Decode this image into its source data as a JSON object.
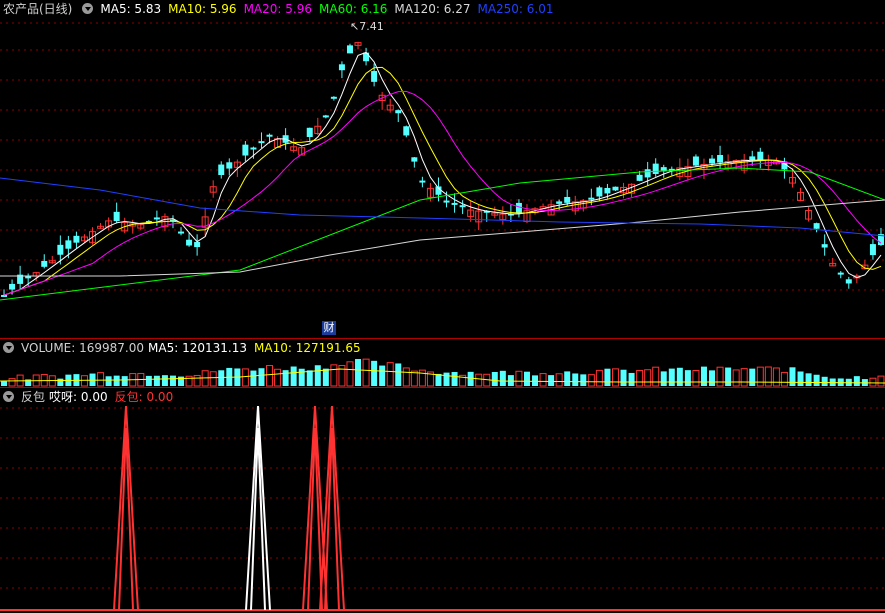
{
  "main": {
    "title": "农产品(日线)",
    "indicators": [
      {
        "label": "MA5:",
        "value": "5.83",
        "color": "#ffffff"
      },
      {
        "label": "MA10:",
        "value": "5.96",
        "color": "#ffff00"
      },
      {
        "label": "MA20:",
        "value": "5.96",
        "color": "#ff00ff"
      },
      {
        "label": "MA60:",
        "value": "6.16",
        "color": "#00ff00"
      },
      {
        "label": "MA120:",
        "value": "6.27",
        "color": "#d8d8d8"
      },
      {
        "label": "MA250:",
        "value": "6.01",
        "color": "#2040ff"
      }
    ],
    "max_price_label": "7.41",
    "finance_marker": "财"
  },
  "volume": {
    "title": "VOLUME:",
    "value": "169987.00",
    "ma5_label": "MA5:",
    "ma5_value": "120131.13",
    "ma10_label": "MA10:",
    "ma10_value": "127191.65"
  },
  "indicator": {
    "name": "反包",
    "line1_label": "哎呀:",
    "line1_value": "0.00",
    "line2_label": "反包:",
    "line2_value": "0.00"
  },
  "colors": {
    "up": "#ff3232",
    "down": "#54ffff",
    "grid": "#8b0000",
    "ma5": "#ffffff",
    "ma10": "#ffff00",
    "ma20": "#ff00ff",
    "ma60": "#00ff00",
    "ma120": "#d8d8d8",
    "ma250": "#2040ff"
  }
}
